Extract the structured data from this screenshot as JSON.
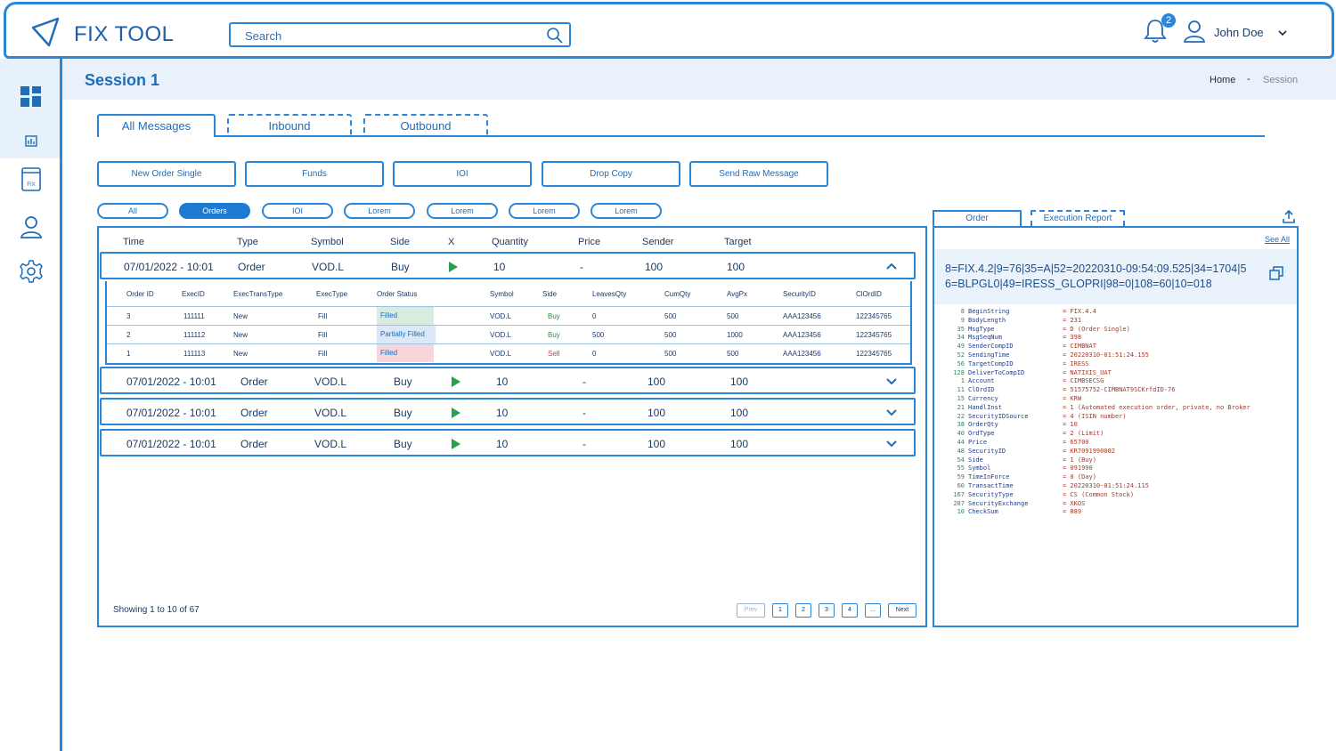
{
  "app": {
    "title": "FIX TOOL"
  },
  "search": {
    "placeholder": "Search"
  },
  "notifications": {
    "count": "2"
  },
  "user": {
    "name": "John Doe"
  },
  "session": {
    "title": "Session 1"
  },
  "breadcrumb": {
    "home": "Home",
    "separator": "-",
    "current": "Session"
  },
  "tabs": [
    {
      "label": "All Messages"
    },
    {
      "label": "Inbound"
    },
    {
      "label": "Outbound"
    }
  ],
  "actions": [
    {
      "label": "New Order Single"
    },
    {
      "label": "Funds"
    },
    {
      "label": "IOI"
    },
    {
      "label": "Drop Copy"
    },
    {
      "label": "Send Raw Message"
    }
  ],
  "filters": [
    {
      "label": "All"
    },
    {
      "label": "Orders"
    },
    {
      "label": "IOI"
    },
    {
      "label": "Lorem"
    },
    {
      "label": "Lorem"
    },
    {
      "label": "Lorem"
    },
    {
      "label": "Lorem"
    }
  ],
  "table": {
    "headers": [
      "Time",
      "Type",
      "Symbol",
      "Side",
      "X",
      "Quantity",
      "Price",
      "Sender",
      "Target"
    ],
    "rows": [
      {
        "time": "07/01/2022 - 10:01",
        "type": "Order",
        "symbol": "VOD.L",
        "side": "Buy",
        "quantity": "10",
        "price": "-",
        "sender": "100",
        "target": "100"
      },
      {
        "time": "07/01/2022 - 10:01",
        "type": "Order",
        "symbol": "VOD.L",
        "side": "Buy",
        "quantity": "10",
        "price": "-",
        "sender": "100",
        "target": "100"
      },
      {
        "time": "07/01/2022 - 10:01",
        "type": "Order",
        "symbol": "VOD.L",
        "side": "Buy",
        "quantity": "10",
        "price": "-",
        "sender": "100",
        "target": "100"
      },
      {
        "time": "07/01/2022 - 10:01",
        "type": "Order",
        "symbol": "VOD.L",
        "side": "Buy",
        "quantity": "10",
        "price": "-",
        "sender": "100",
        "target": "100"
      }
    ],
    "sub": {
      "headers": [
        "Order ID",
        "ExecID",
        "ExecTransType",
        "ExecType",
        "Order Status",
        "Symbol",
        "Side",
        "LeavesQty",
        "CumQty",
        "AvgPx",
        "SecurityID",
        "ClOrdID"
      ],
      "rows": [
        {
          "order_id": "3",
          "exec_id": "111111",
          "trans": "New",
          "exec_type": "Fill",
          "status": "Filled",
          "symbol": "VOD.L",
          "side": "Buy",
          "leaves": "0",
          "cum": "500",
          "avg": "500",
          "sec": "AAA123456",
          "clord": "122345765"
        },
        {
          "order_id": "2",
          "exec_id": "111112",
          "trans": "New",
          "exec_type": "Fill",
          "status": "Partially Filled",
          "symbol": "VOD.L",
          "side": "Buy",
          "leaves": "500",
          "cum": "500",
          "avg": "1000",
          "sec": "AAA123456",
          "clord": "122345765"
        },
        {
          "order_id": "1",
          "exec_id": "111113",
          "trans": "New",
          "exec_type": "Fill",
          "status": "Filled",
          "symbol": "VOD.L",
          "side": "Sell",
          "leaves": "0",
          "cum": "500",
          "avg": "500",
          "sec": "AAA123456",
          "clord": "122345765"
        }
      ]
    },
    "showing": "Showing 1 to 10 of 67",
    "pagination": {
      "prev": "Prev",
      "pages": [
        "1",
        "2",
        "3",
        "4",
        "..."
      ],
      "next": "Next"
    }
  },
  "detail": {
    "tabs": [
      {
        "label": "Order"
      },
      {
        "label": "Execution Report"
      }
    ],
    "see_all": "See All",
    "raw": "8=FIX.4.2|9=76|35=A|52=20220310-09:54:09.525|34=1704|56=BLPGL0|49=IRESS_GLOPRI|98=0|108=60|10=018",
    "fields": [
      {
        "tag": "8",
        "name": "BeginString",
        "value": "= FIX.4.4"
      },
      {
        "tag": "9",
        "name": "BodyLength",
        "value": "= 231"
      },
      {
        "tag": "35",
        "name": "MsgType",
        "value": "= D (Order Single)"
      },
      {
        "tag": "34",
        "name": "MsgSeqNum",
        "value": "= 398"
      },
      {
        "tag": "49",
        "name": "SenderCompID",
        "value": "= CIMBNAT"
      },
      {
        "tag": "52",
        "name": "SendingTime",
        "value": "= 20220310-01:51:24.155"
      },
      {
        "tag": "56",
        "name": "TargetCompID",
        "value": "= IRESS"
      },
      {
        "tag": "128",
        "name": "DeliverToCompID",
        "value": "= NATIXIS_UAT"
      },
      {
        "tag": "1",
        "name": "Account",
        "value": "= CIMBSECSG"
      },
      {
        "tag": "11",
        "name": "ClOrdID",
        "value": "= 51575752-CIMBNAT9SCKrfdID-76"
      },
      {
        "tag": "15",
        "name": "Currency",
        "value": "= KRW"
      },
      {
        "tag": "21",
        "name": "HandlInst",
        "value": "= 1 (Automated execution order, private, no Broker"
      },
      {
        "tag": "22",
        "name": "SecurityIDSource",
        "value": "= 4 (ISIN number)"
      },
      {
        "tag": "38",
        "name": "OrderQty",
        "value": "= 10"
      },
      {
        "tag": "40",
        "name": "OrdType",
        "value": "= 2 (Limit)"
      },
      {
        "tag": "44",
        "name": "Price",
        "value": "= 65700"
      },
      {
        "tag": "48",
        "name": "SecurityID",
        "value": "= KR7091990002"
      },
      {
        "tag": "54",
        "name": "Side",
        "value": "= 1 (Buy)"
      },
      {
        "tag": "55",
        "name": "Symbol",
        "value": "= 091990"
      },
      {
        "tag": "59",
        "name": "TimeInForce",
        "value": "= 0 (Day)"
      },
      {
        "tag": "60",
        "name": "TransactTime",
        "value": "= 20220310-01:51:24.115"
      },
      {
        "tag": "167",
        "name": "SecurityType",
        "value": "= CS (Common Stock)"
      },
      {
        "tag": "207",
        "name": "SecurityExchange",
        "value": "= XKOS"
      },
      {
        "tag": "10",
        "name": "CheckSum",
        "value": "= 089"
      }
    ]
  },
  "colors": {
    "accent": "#2a86d8",
    "play": "#27a047",
    "filled_bg": "#d9ecdf",
    "partial_bg": "#dbe9f6",
    "sell_bg": "#f6d6d8"
  }
}
